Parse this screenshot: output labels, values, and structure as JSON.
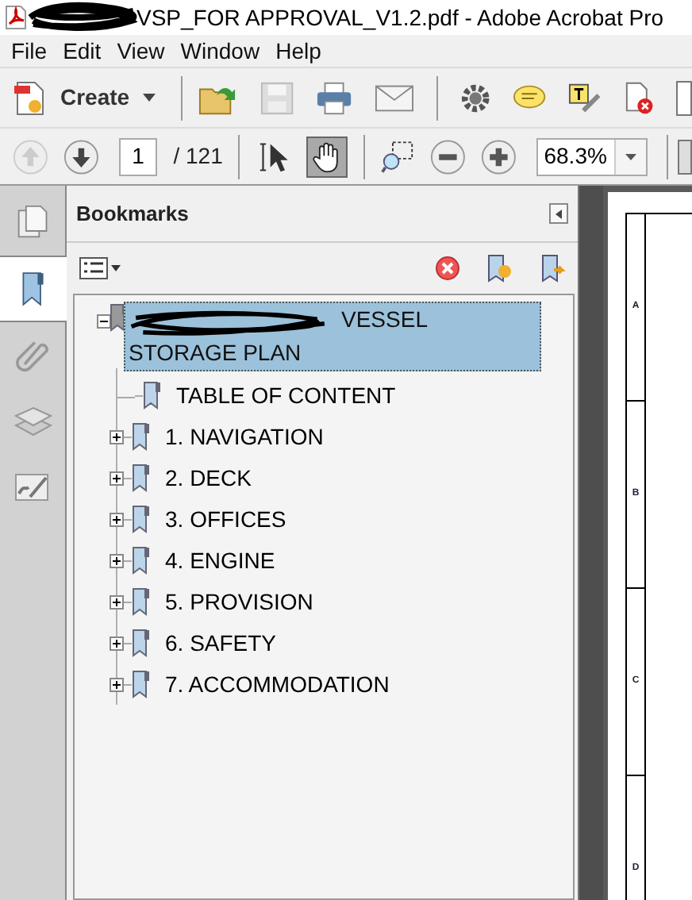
{
  "window": {
    "title": "VSP_FOR APPROVAL_V1.2.pdf - Adobe Acrobat Pro"
  },
  "menu": [
    "File",
    "Edit",
    "View",
    "Window",
    "Help"
  ],
  "toolbar": {
    "create_label": "Create"
  },
  "navigation": {
    "page": "1",
    "page_count": "/ 121",
    "zoom": "68.3%"
  },
  "tools": [
    {
      "kind": "select",
      "selected": false
    },
    {
      "kind": "hand",
      "selected": true
    }
  ],
  "side_tabs": [
    {
      "kind": "pages",
      "selected": false
    },
    {
      "kind": "bookmarks",
      "selected": true
    },
    {
      "kind": "attachments",
      "selected": false
    },
    {
      "kind": "layers",
      "selected": false
    },
    {
      "kind": "signatures",
      "selected": false
    }
  ],
  "bookmarks_panel": {
    "title": "Bookmarks",
    "tree": [
      {
        "label": "VESSEL STORAGE PLAN",
        "expanded": true,
        "selected": true,
        "children": [
          {
            "label": "TABLE OF CONTENT",
            "selected": false
          },
          {
            "label": "1. NAVIGATION",
            "expanded": false,
            "selected": false
          },
          {
            "label": "2. DECK",
            "expanded": false,
            "selected": false
          },
          {
            "label": "3. OFFICES",
            "expanded": false,
            "selected": false
          },
          {
            "label": "4. ENGINE",
            "expanded": false,
            "selected": false
          },
          {
            "label": "5. PROVISION",
            "expanded": false,
            "selected": false
          },
          {
            "label": "6. SAFETY",
            "expanded": false,
            "selected": false
          },
          {
            "label": "7. ACCOMMODATION",
            "expanded": false,
            "selected": false
          }
        ]
      }
    ]
  },
  "document": {
    "row_labels": [
      "A",
      "B",
      "C",
      "D"
    ]
  }
}
